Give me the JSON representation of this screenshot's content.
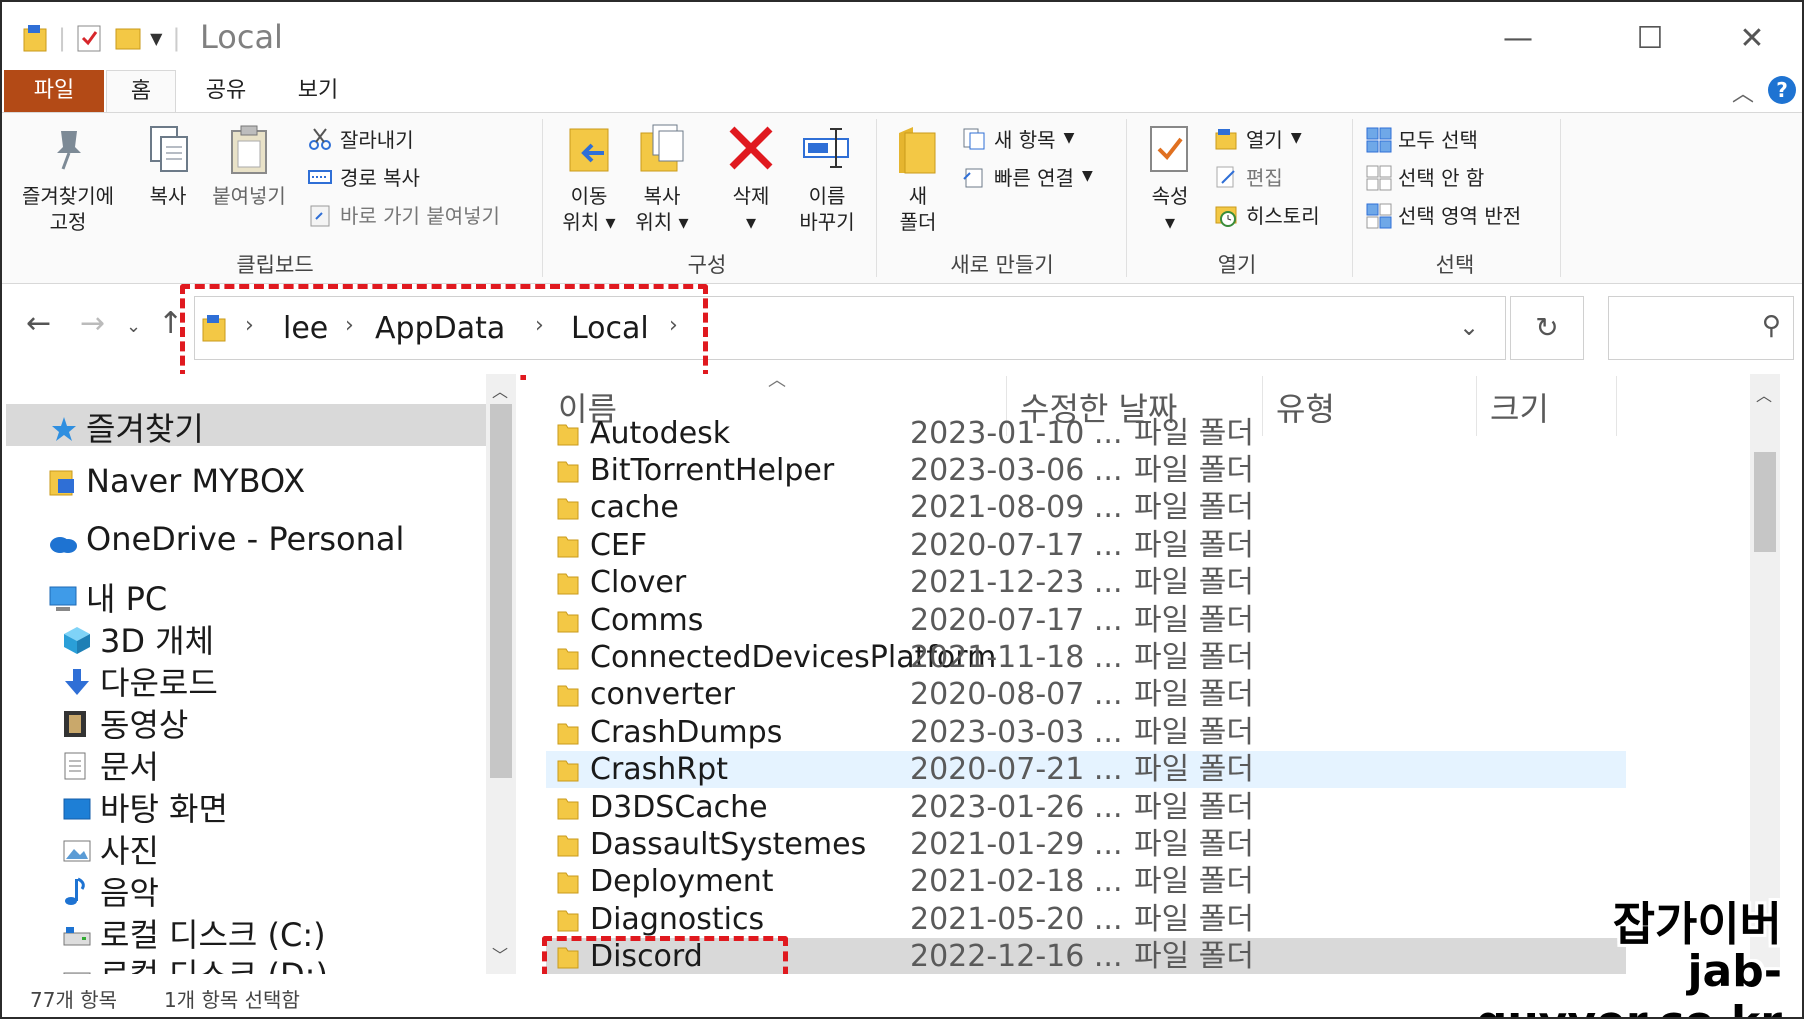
{
  "window": {
    "title": "Local",
    "controls": {
      "minimize": "—",
      "maximize": "☐",
      "close": "✕"
    }
  },
  "tabs": [
    {
      "label": "파일"
    },
    {
      "label": "홈"
    },
    {
      "label": "공유"
    },
    {
      "label": "보기"
    }
  ],
  "ribbon": {
    "clipboard": {
      "title": "클립보드",
      "pin": "즐겨찾기에",
      "pin2": "고정",
      "copy": "복사",
      "paste": "붙여넣기",
      "cut": "잘라내기",
      "copy_path": "경로 복사",
      "paste_shortcut": "바로 가기 붙여넣기"
    },
    "organize": {
      "title": "구성",
      "move_to": "이동",
      "move_to2": "위치",
      "copy_to": "복사",
      "copy_to2": "위치",
      "delete": "삭제",
      "rename": "이름",
      "rename2": "바꾸기"
    },
    "new": {
      "title": "새로 만들기",
      "new_folder": "새",
      "new_folder2": "폴더",
      "new_item": "새 항목",
      "easy_access": "빠른 연결"
    },
    "open": {
      "title": "열기",
      "properties": "속성",
      "open": "열기",
      "edit": "편집",
      "history": "히스토리"
    },
    "select": {
      "title": "선택",
      "select_all": "모두 선택",
      "select_none": "선택 안 함",
      "invert": "선택 영역 반전"
    }
  },
  "address": {
    "crumbs": [
      "lee",
      "AppData",
      "Local"
    ]
  },
  "nav": {
    "items": [
      {
        "label": "즐겨찾기",
        "icon": "star-icon"
      },
      {
        "label": "Naver MYBOX",
        "icon": "cloud-drive-icon"
      },
      {
        "label": "OneDrive - Personal",
        "icon": "onedrive-cloud-icon"
      },
      {
        "label": "내 PC",
        "icon": "pc-icon"
      },
      {
        "label": "3D 개체",
        "icon": "cube-icon"
      },
      {
        "label": "다운로드",
        "icon": "download-arrow-icon"
      },
      {
        "label": "동영상",
        "icon": "film-icon"
      },
      {
        "label": "문서",
        "icon": "document-icon"
      },
      {
        "label": "바탕 화면",
        "icon": "desktop-icon"
      },
      {
        "label": "사진",
        "icon": "picture-icon"
      },
      {
        "label": "음악",
        "icon": "music-note-icon"
      },
      {
        "label": "로컬 디스크 (C:)",
        "icon": "drive-icon"
      },
      {
        "label": "로컬 디스크 (D:)",
        "icon": "drive-icon"
      }
    ]
  },
  "columns": {
    "name": "이름",
    "date": "수정한 날짜",
    "type": "유형",
    "size": "크기"
  },
  "files": [
    {
      "name": "Autodesk",
      "date": "2023-01-10 ...",
      "type": "파일 폴더"
    },
    {
      "name": "BitTorrentHelper",
      "date": "2023-03-06 ...",
      "type": "파일 폴더"
    },
    {
      "name": "cache",
      "date": "2021-08-09 ...",
      "type": "파일 폴더"
    },
    {
      "name": "CEF",
      "date": "2020-07-17 ...",
      "type": "파일 폴더"
    },
    {
      "name": "Clover",
      "date": "2021-12-23 ...",
      "type": "파일 폴더"
    },
    {
      "name": "Comms",
      "date": "2020-07-17 ...",
      "type": "파일 폴더"
    },
    {
      "name": "ConnectedDevicesPlatform",
      "date": "2021-11-18 ...",
      "type": "파일 폴더"
    },
    {
      "name": "converter",
      "date": "2020-08-07 ...",
      "type": "파일 폴더"
    },
    {
      "name": "CrashDumps",
      "date": "2023-03-03 ...",
      "type": "파일 폴더"
    },
    {
      "name": "CrashRpt",
      "date": "2020-07-21 ...",
      "type": "파일 폴더"
    },
    {
      "name": "D3DSCache",
      "date": "2023-01-26 ...",
      "type": "파일 폴더"
    },
    {
      "name": "DassaultSystemes",
      "date": "2021-01-29 ...",
      "type": "파일 폴더"
    },
    {
      "name": "Deployment",
      "date": "2021-02-18 ...",
      "type": "파일 폴더"
    },
    {
      "name": "Diagnostics",
      "date": "2021-05-20 ...",
      "type": "파일 폴더"
    },
    {
      "name": "Discord",
      "date": "2022-12-16 ...",
      "type": "파일 폴더"
    }
  ],
  "status": {
    "count": "77개 항목",
    "selected": "1개 항목 선택함"
  },
  "watermark": {
    "line1": "잡가이버",
    "line2": "jab-guyver.co.kr"
  },
  "colors": {
    "file_tab": "#b34a16",
    "highlight_red": "#e0191f",
    "folder": "#f3c845",
    "help": "#1e73d2"
  }
}
